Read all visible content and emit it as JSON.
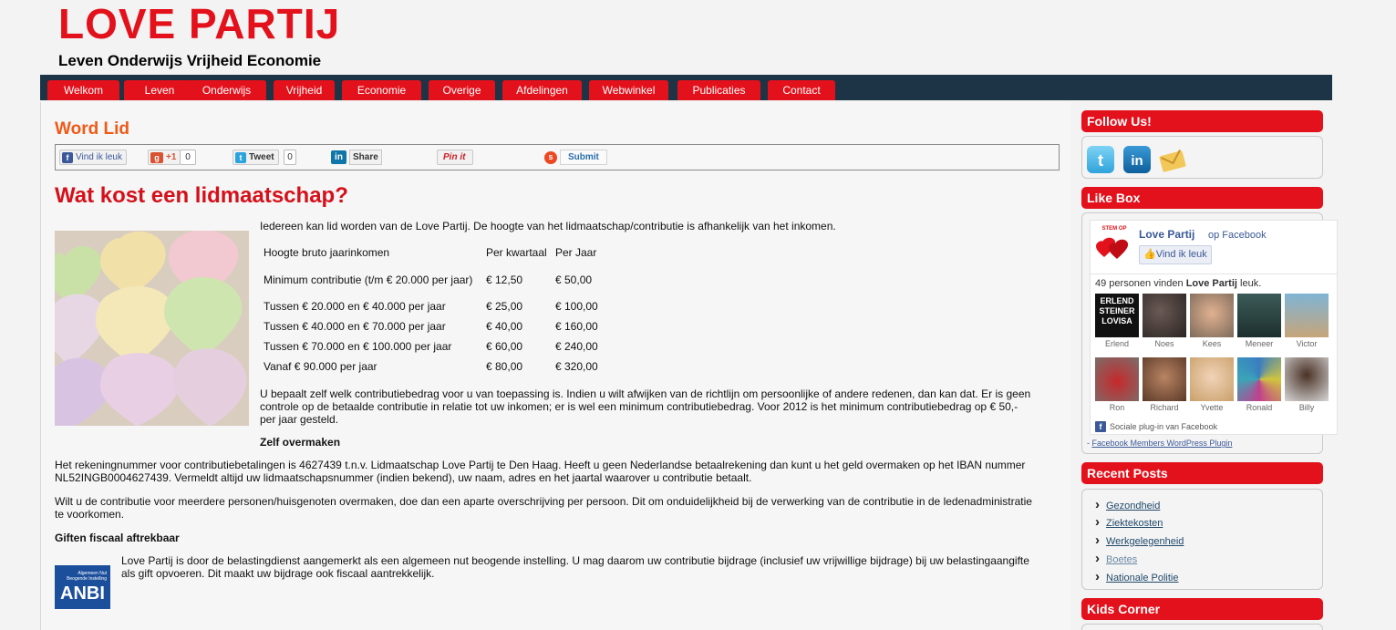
{
  "site": {
    "title": "LOVE PARTIJ",
    "tagline": "Leven Onderwijs Vrijheid Economie"
  },
  "nav": [
    "Welkom",
    "Leven",
    "Onderwijs",
    "Vrijheid",
    "Economie",
    "Overige",
    "Afdelingen",
    "Webwinkel",
    "Publicaties",
    "Contact"
  ],
  "page": {
    "section_title": "Word Lid",
    "heading": "Wat kost een lidmaatschap?",
    "intro": "Iedereen kan lid worden van de Love Partij. De hoogte van het lidmaatschap/contributie is afhankelijk van het inkomen.",
    "table": {
      "headers": [
        "Hoogte bruto jaarinkomen",
        "Per kwartaal",
        "Per Jaar"
      ],
      "rows": [
        [
          "Minimum contributie (t/m € 20.000 per jaar)",
          "€ 12,50",
          "€ 50,00"
        ],
        [
          "Tussen € 20.000 en € 40.000 per jaar",
          "€ 25,00",
          "€ 100,00"
        ],
        [
          "Tussen € 40.000 en € 70.000 per jaar",
          "€ 40,00",
          "€ 160,00"
        ],
        [
          "Tussen € 70.000 en € 100.000 per jaar",
          "€ 60,00",
          "€ 240,00"
        ],
        [
          "Vanaf € 90.000 per jaar",
          "€ 80,00",
          "€ 320,00"
        ]
      ]
    },
    "para1_line1": "U bepaalt zelf welk contributiebedrag voor u van toepassing is. Indien u wilt afwijken van de richtlijn om persoonlijke of andere redenen, dan kan dat. Er is geen",
    "para1_line2": "controle op de betaalde contributie in relatie tot uw inkomen; er is wel een minimum contributiebedrag. Voor 2012 is het minimum contributiebedrag op € 50,-",
    "para1_line3": "per jaar gesteld.",
    "zelf_heading": "Zelf overmaken",
    "para2_line1": "Het rekeningnummer voor contributiebetalingen is 4627439 t.n.v. Lidmaatschap Love Partij te Den Haag. Heeft u geen Nederlandse betaalrekening dan kunt u het geld overmaken op het IBAN nummer",
    "para2_line2": "NL52INGB0004627439. Vermeldt altijd uw lidmaatschapsnummer (indien bekend), uw naam, adres en het jaartal waarover u contributie betaalt.",
    "para3_line1": "Wilt u de contributie voor meerdere personen/huisgenoten overmaken, doe dan een aparte overschrijving per persoon. Dit om onduidelijkheid bij de verwerking van de contributie in de ledenadministratie",
    "para3_line2": "te voorkomen.",
    "giften_heading": "Giften fiscaal aftrekbaar",
    "para4_line1": "Love Partij is door de belastingdienst aangemerkt als een algemeen nut beogende instelling. U mag daarom uw contributie bijdrage (inclusief uw vrijwillige bijdrage) bij uw belastingaangifte",
    "para4_line2": "als gift opvoeren. Dit maakt uw bijdrage ook fiscaal aantrekkelijk.",
    "anbi_small": "Algemeen Nut Beogende Instelling",
    "anbi_label": "ANBI"
  },
  "share": {
    "facebook": "Vind ik leuk",
    "gplus": "+1",
    "gplus_count": "0",
    "tweet": "Tweet",
    "tweet_count": "0",
    "linkedin": "Share",
    "pinit": "Pin it",
    "submit": "Submit"
  },
  "sidebar": {
    "follow_title": "Follow Us!",
    "like_title": "Like Box",
    "fb_page_name": "Love Partij",
    "fb_on": "op Facebook",
    "fb_like_button": "Vind ik leuk",
    "fb_logo_text": "STEM OP",
    "fb_count_prefix": "49 personen vinden",
    "fb_count_name": "Love Partij",
    "fb_count_suffix": "leuk.",
    "fans": [
      "Erlend",
      "Noes",
      "Kees",
      "Meneer",
      "Victor",
      "Ron",
      "Richard",
      "Yvette",
      "Ronald",
      "Billy"
    ],
    "fan1_text": "ERLEND STEINER LOVISA",
    "fb_plugin": "Sociale plug-in van Facebook",
    "fb_plugin_link": "Facebook Members WordPress Plugin",
    "recent_title": "Recent Posts",
    "recent": [
      "Gezondheid",
      "Ziektekosten",
      "Werkgelegenheid",
      "Boetes",
      "Nationale Politie"
    ],
    "kids_title": "Kids Corner"
  },
  "colors": {
    "brand_red": "#e3111b",
    "nav_bg": "#1c3446",
    "section_orange": "#ef5a17"
  }
}
